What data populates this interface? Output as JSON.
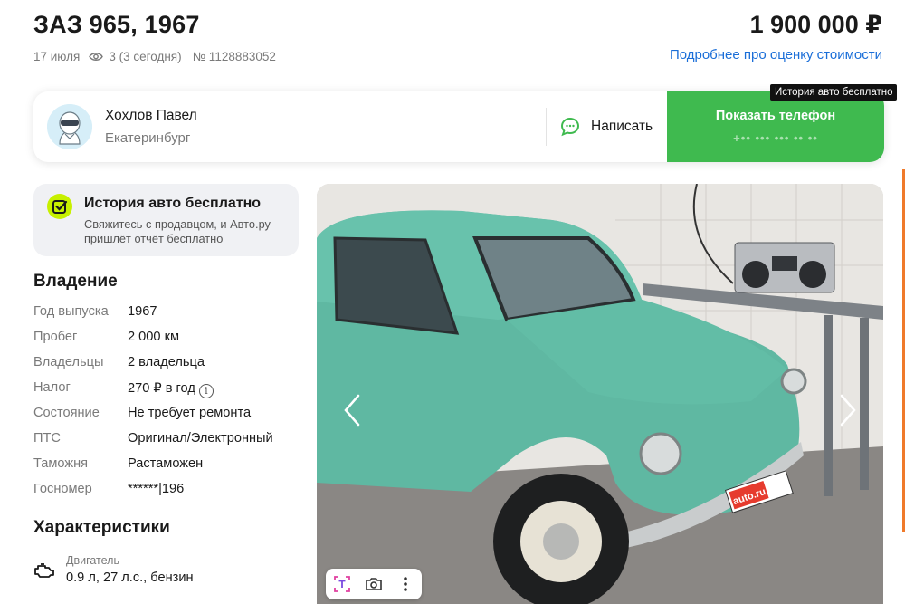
{
  "listing": {
    "title": "ЗАЗ 965, 1967",
    "date": "17 июля",
    "views": "3 (3 сегодня)",
    "number": "№ 1128883052",
    "price": "1 900 000 ₽",
    "price_link": "Подробнее про оценку стоимости"
  },
  "seller": {
    "name": "Хохлов Павел",
    "city": "Екатеринбург",
    "write_label": "Написать",
    "phone_label": "Показать телефон",
    "phone_masked": "+•• ••• ••• •• ••",
    "tooltip": "История авто бесплатно"
  },
  "history": {
    "title": "История авто бесплатно",
    "text": "Свяжитесь с продавцом, и Авто.ру пришлёт отчёт бесплатно"
  },
  "ownership": {
    "title": "Владение",
    "rows": [
      {
        "key": "Год выпуска",
        "value": "1967"
      },
      {
        "key": "Пробег",
        "value": "2 000 км"
      },
      {
        "key": "Владельцы",
        "value": "2 владельца"
      },
      {
        "key": "Налог",
        "value": "270 ₽ в год"
      },
      {
        "key": "Состояние",
        "value": "Не требует ремонта"
      },
      {
        "key": "ПТС",
        "value": "Оригинал/Электронный"
      },
      {
        "key": "Таможня",
        "value": "Растаможен"
      },
      {
        "key": "Госномер",
        "value": "******|196"
      }
    ]
  },
  "characteristics": {
    "title": "Характеристики",
    "engine_label": "Двигатель",
    "engine_value": "0.9 л, 27 л.с., бензин"
  },
  "photo": {
    "plate_text": "auto.ru",
    "tools": [
      "text-recognition-icon",
      "camera-search-icon",
      "more-icon"
    ]
  },
  "colors": {
    "accent_green": "#3fba4f",
    "link_blue": "#1a6ed8",
    "car_teal": "#5fb8a2",
    "history_badge": "#c7f000"
  }
}
